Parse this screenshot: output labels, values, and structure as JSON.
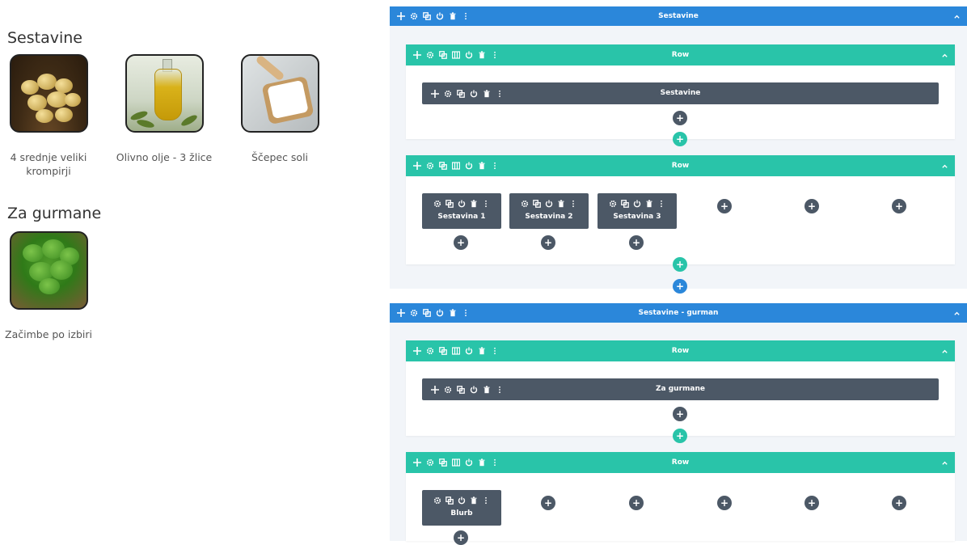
{
  "preview": {
    "section1_title": "Sestavine",
    "section2_title": "Za gurmane",
    "ingredients": [
      {
        "caption": "4 srednje veliki krompirji",
        "image": "potatoes-image"
      },
      {
        "caption": "Olivno olje - 3 žlice",
        "image": "olive-oil-image"
      },
      {
        "caption": "Ščepec soli",
        "image": "salt-image"
      }
    ],
    "gourmet": [
      {
        "caption": "Začimbe po izbiri",
        "image": "parsley-image"
      }
    ]
  },
  "builder": {
    "colors": {
      "section": "#2b87da",
      "row": "#29c4a9",
      "module": "#4c5866"
    },
    "sections": [
      {
        "title": "Sestavine",
        "rows": [
          {
            "title": "Row",
            "module": "Sestavine"
          },
          {
            "title": "Row",
            "columns": [
              "Sestavina 1",
              "Sestavina 2",
              "Sestavina 3"
            ]
          }
        ]
      },
      {
        "title": "Sestavine - gurman",
        "rows": [
          {
            "title": "Row",
            "module": "Za gurmane"
          },
          {
            "title": "Row",
            "columns": [
              "Blurb"
            ]
          }
        ]
      }
    ],
    "icons": {
      "move": "move-icon",
      "settings": "gear-icon",
      "duplicate": "duplicate-icon",
      "columns": "columns-icon",
      "toggle": "power-icon",
      "delete": "trash-icon",
      "more": "more-icon",
      "collapse": "chevron-up-icon",
      "add": "plus-icon"
    },
    "add_label": "+"
  }
}
